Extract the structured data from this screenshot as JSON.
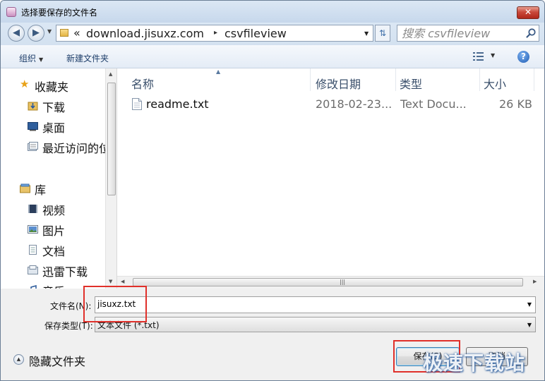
{
  "window": {
    "title": "选择要保存的文件名",
    "close_glyph": "✕"
  },
  "address": {
    "overflow": "«",
    "segments": [
      "download.jisuxz.com",
      "csvfileview"
    ],
    "separator": "▸"
  },
  "search": {
    "placeholder": "搜索 csvfileview"
  },
  "toolbar": {
    "organize": "组织",
    "new_folder": "新建文件夹",
    "help": "?"
  },
  "nav": {
    "favorites": {
      "label": "收藏夹",
      "items": [
        "下载",
        "桌面",
        "最近访问的位置"
      ]
    },
    "libraries": {
      "label": "库",
      "items": [
        "视频",
        "图片",
        "文档",
        "迅雷下载",
        "音乐"
      ]
    }
  },
  "columns": {
    "name": "名称",
    "date": "修改日期",
    "type": "类型",
    "size": "大小"
  },
  "files": [
    {
      "name": "readme.txt",
      "date": "2018-02-23...",
      "type": "Text Docu...",
      "size": "26 KB"
    }
  ],
  "form": {
    "filename_label": "文件名(N):",
    "filename_value": "jisuxz.txt",
    "filetype_label": "保存类型(T):",
    "filetype_value": "文本文件 (*.txt)"
  },
  "footer": {
    "hide_folders": "隐藏文件夹",
    "save": "保存(S)",
    "cancel": "取消"
  },
  "watermark": "极速下载站",
  "colors": {
    "highlight_box": "#e0302a",
    "title_bar": "#dbe7f4",
    "close_button": "#c9483a"
  }
}
